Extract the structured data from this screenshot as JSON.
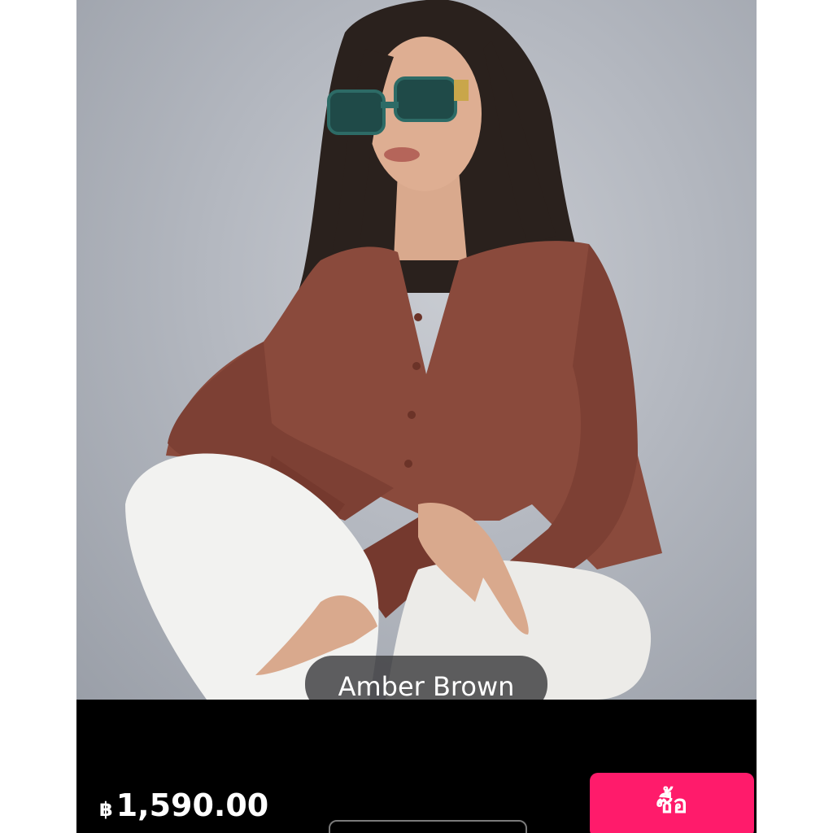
{
  "product_image": {
    "alt_icon": "product-photo",
    "colors": {
      "background": "#b4b8c0",
      "cardigan": "#8a4a3c",
      "pants": "#f2f2f0",
      "hair": "#2a211d",
      "sunglasses": "#1f4a48"
    }
  },
  "variant": {
    "color_name": "Amber Brown"
  },
  "purchase_bar": {
    "currency_symbol": "฿",
    "price": "1,590.00",
    "buy_label": "ซื้อ",
    "buy_color": "#ff1b6b"
  }
}
